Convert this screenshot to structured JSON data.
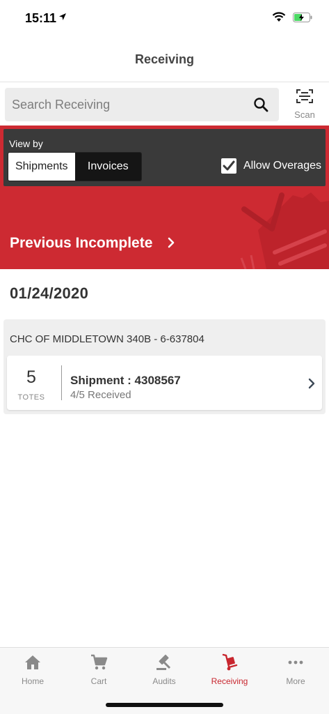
{
  "status": {
    "time": "15:11"
  },
  "header": {
    "title": "Receiving"
  },
  "search": {
    "placeholder": "Search Receiving",
    "scan_label": "Scan"
  },
  "view_by": {
    "label": "View by",
    "options": [
      "Shipments",
      "Invoices"
    ],
    "selected": "Shipments",
    "allow_overages_label": "Allow Overages",
    "allow_overages_checked": true
  },
  "banner": {
    "label": "Previous Incomplete"
  },
  "date_heading": "01/24/2020",
  "group": {
    "title": "CHC OF MIDDLETOWN 340B - 6-637804",
    "shipments": [
      {
        "totes": "5",
        "totes_label": "TOTES",
        "title": "Shipment : 4308567",
        "status": "4/5 Received"
      }
    ]
  },
  "tabs": [
    {
      "label": "Home",
      "icon": "home-icon"
    },
    {
      "label": "Cart",
      "icon": "cart-icon"
    },
    {
      "label": "Audits",
      "icon": "gavel-icon"
    },
    {
      "label": "Receiving",
      "icon": "hand-truck-icon",
      "active": true
    },
    {
      "label": "More",
      "icon": "more-icon"
    }
  ],
  "colors": {
    "brand_red": "#cd2a32",
    "dark_panel": "#3a3a3a",
    "active_tab": "#c8262e"
  }
}
